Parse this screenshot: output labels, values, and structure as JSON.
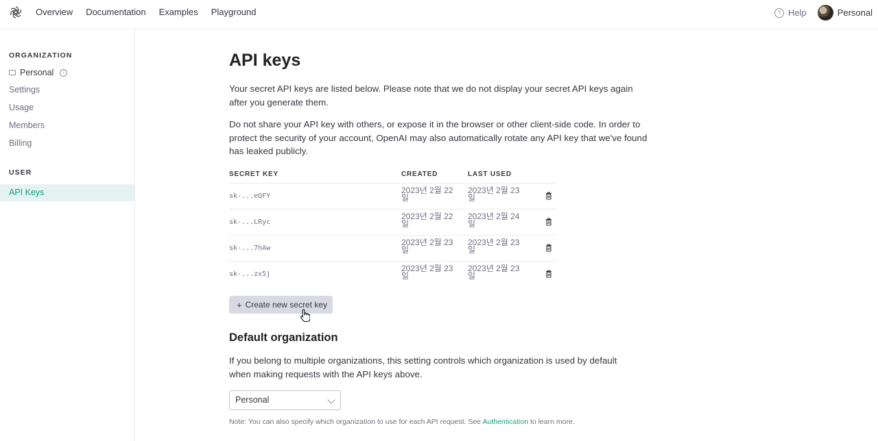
{
  "nav": {
    "links": [
      "Overview",
      "Documentation",
      "Examples",
      "Playground"
    ],
    "help": "Help",
    "account": "Personal"
  },
  "sidebar": {
    "org_heading": "ORGANIZATION",
    "org_name": "Personal",
    "org_items": [
      "Settings",
      "Usage",
      "Members",
      "Billing"
    ],
    "user_heading": "USER",
    "active_item": "API Keys"
  },
  "main": {
    "title": "API keys",
    "para1": "Your secret API keys are listed below. Please note that we do not display your secret API keys again after you generate them.",
    "para2": "Do not share your API key with others, or expose it in the browser or other client-side code. In order to protect the security of your account, OpenAI may also automatically rotate any API key that we've found has leaked publicly.",
    "table": {
      "headers": [
        "SECRET KEY",
        "CREATED",
        "LAST USED"
      ],
      "rows": [
        {
          "key": "sk-...eQFY",
          "created": "2023년 2월 22일",
          "last_used": "2023년 2월 23일"
        },
        {
          "key": "sk-...LRyc",
          "created": "2023년 2월 22일",
          "last_used": "2023년 2월 24일"
        },
        {
          "key": "sk-...7hAw",
          "created": "2023년 2월 23일",
          "last_used": "2023년 2월 23일"
        },
        {
          "key": "sk-...zx5j",
          "created": "2023년 2월 23일",
          "last_used": "2023년 2월 23일"
        }
      ]
    },
    "create_button": "Create new secret key",
    "default_org_heading": "Default organization",
    "para3": "If you belong to multiple organizations, this setting controls which organization is used by default when making requests with the API keys above.",
    "select_value": "Personal",
    "note_prefix": "Note: You can also specify which organization to use for each API request. See ",
    "note_link": "Authentication",
    "note_suffix": " to learn more."
  }
}
